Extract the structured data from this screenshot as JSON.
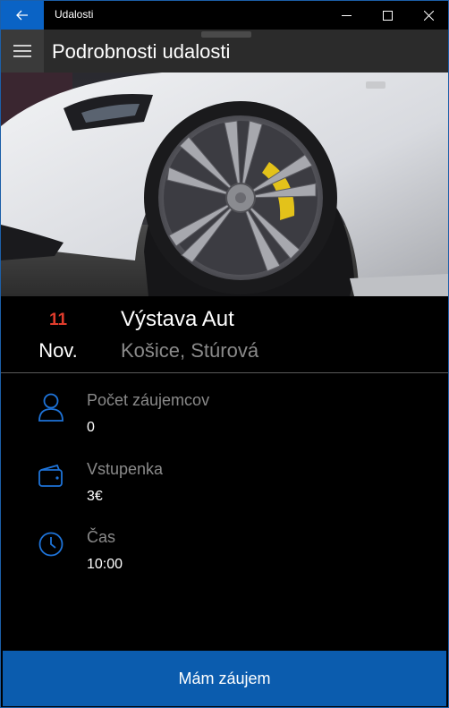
{
  "window": {
    "title": "Udalosti",
    "back_icon": "arrow-left-icon",
    "minimize_icon": "minimize-icon",
    "maximize_icon": "maximize-icon",
    "close_icon": "close-icon"
  },
  "header": {
    "menu_icon": "hamburger-menu-icon",
    "title": "Podrobnosti udalosti"
  },
  "event": {
    "day": "11",
    "month": "Nov.",
    "name": "Výstava Aut",
    "location": "Košice, Stúrová",
    "day_color": "#e03c2c"
  },
  "details": [
    {
      "icon": "person-icon",
      "label": "Počet záujemcov",
      "value": "0"
    },
    {
      "icon": "wallet-icon",
      "label": "Vstupenka",
      "value": "3€"
    },
    {
      "icon": "clock-icon",
      "label": "Čas",
      "value": "10:00"
    }
  ],
  "action": {
    "label": "Mám záujem",
    "color": "#0b5cae"
  },
  "colors": {
    "accent": "#0a63c5",
    "icon_blue": "#1e73d8"
  }
}
